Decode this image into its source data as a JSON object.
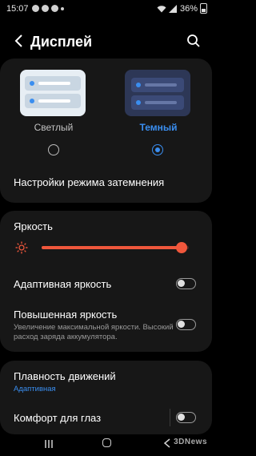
{
  "status_bar": {
    "time": "15:07",
    "battery": "36%"
  },
  "header": {
    "title": "Дисплей"
  },
  "theme": {
    "light_label": "Светлый",
    "dark_label": "Темный",
    "selected": "dark"
  },
  "dark_mode_settings_label": "Настройки режима затемнения",
  "brightness": {
    "label": "Яркость",
    "level": 0.95,
    "accent_color": "#f0573c"
  },
  "adaptive_brightness": {
    "label": "Адаптивная яркость",
    "enabled": false
  },
  "extra_brightness": {
    "label": "Повышенная яркость",
    "description": "Увеличение максимальной яркости. Высокий расход заряда аккумулятора.",
    "enabled": false
  },
  "motion_smoothness": {
    "label": "Плавность движений",
    "value": "Адаптивная"
  },
  "eye_comfort": {
    "label": "Комфорт для глаз",
    "enabled": false
  },
  "watermark": "3DNews",
  "colors": {
    "accent_blue": "#3a8ef0",
    "background": "#000000",
    "card": "#171717"
  }
}
